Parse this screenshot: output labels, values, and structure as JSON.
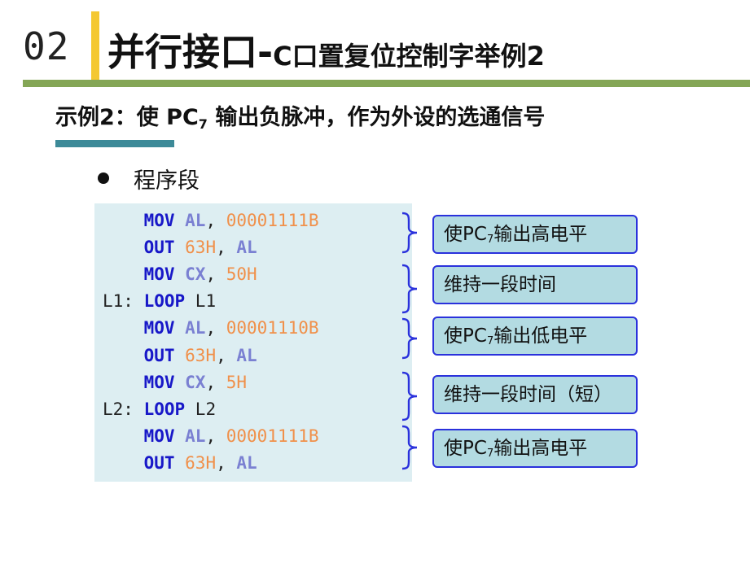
{
  "header": {
    "section_number": "02",
    "title_main": "并行接口-",
    "title_sub": "C口置复位控制字举例2"
  },
  "example": {
    "prefix": "示例2：使 PC",
    "subscript": "7",
    "suffix": " 输出负脉冲，作为外设的选通信号"
  },
  "bullet": {
    "label": "程序段"
  },
  "code": [
    {
      "label": "",
      "op": "MOV",
      "args": [
        {
          "t": "AL",
          "k": "reg"
        },
        {
          "t": ", ",
          "k": "plain"
        },
        {
          "t": "00001111B",
          "k": "num"
        }
      ]
    },
    {
      "label": "",
      "op": "OUT",
      "args": [
        {
          "t": "63H",
          "k": "num"
        },
        {
          "t": ", ",
          "k": "plain"
        },
        {
          "t": "AL",
          "k": "reg"
        }
      ]
    },
    {
      "label": "",
      "op": "MOV",
      "args": [
        {
          "t": "CX",
          "k": "reg"
        },
        {
          "t": ", ",
          "k": "plain"
        },
        {
          "t": "50H",
          "k": "num"
        }
      ]
    },
    {
      "label": "L1: ",
      "op": "LOOP",
      "args": [
        {
          "t": "L1",
          "k": "plain"
        }
      ]
    },
    {
      "label": "",
      "op": "MOV",
      "args": [
        {
          "t": "AL",
          "k": "reg"
        },
        {
          "t": ", ",
          "k": "plain"
        },
        {
          "t": "00001110B",
          "k": "num"
        }
      ]
    },
    {
      "label": "",
      "op": "OUT",
      "args": [
        {
          "t": "63H",
          "k": "num"
        },
        {
          "t": ", ",
          "k": "plain"
        },
        {
          "t": "AL",
          "k": "reg"
        }
      ]
    },
    {
      "label": "",
      "op": "MOV",
      "args": [
        {
          "t": "CX",
          "k": "reg"
        },
        {
          "t": ", ",
          "k": "plain"
        },
        {
          "t": "5H",
          "k": "num"
        }
      ]
    },
    {
      "label": "L2: ",
      "op": "LOOP",
      "args": [
        {
          "t": "L2",
          "k": "plain"
        }
      ]
    },
    {
      "label": "",
      "op": "MOV",
      "args": [
        {
          "t": "AL",
          "k": "reg"
        },
        {
          "t": ", ",
          "k": "plain"
        },
        {
          "t": "00001111B",
          "k": "num"
        }
      ]
    },
    {
      "label": "",
      "op": "OUT",
      "args": [
        {
          "t": "63H",
          "k": "num"
        },
        {
          "t": ", ",
          "k": "plain"
        },
        {
          "t": "AL",
          "k": "reg"
        }
      ]
    }
  ],
  "annotations": [
    {
      "text_before": "使PC",
      "sub": "7",
      "text_after": "输出高电平"
    },
    {
      "text_before": "维持一段时间",
      "sub": "",
      "text_after": ""
    },
    {
      "text_before": "使PC",
      "sub": "7",
      "text_after": "输出低电平"
    },
    {
      "text_before": "维持一段时间（短）",
      "sub": "",
      "text_after": ""
    },
    {
      "text_before": "使PC",
      "sub": "7",
      "text_after": "输出高电平"
    }
  ],
  "colors": {
    "accent_yellow": "#f4c832",
    "rule_green": "#84a656",
    "underline_teal": "#3d8a98",
    "code_bg": "#ddeef2",
    "keyword": "#1818c8",
    "register": "#7a80d2",
    "number": "#f0904a",
    "note_bg": "#b3dbe2",
    "note_border": "#2a31dc"
  }
}
